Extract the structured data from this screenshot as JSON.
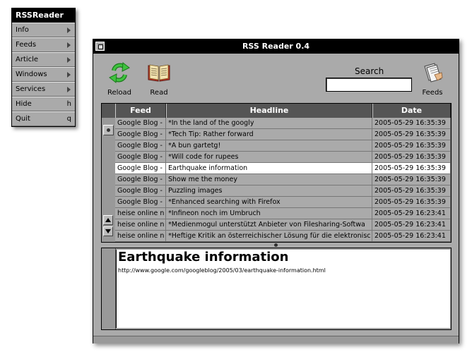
{
  "app_menu": {
    "title": "RSSReader",
    "items": [
      {
        "label": "Info",
        "key": ""
      },
      {
        "label": "Feeds",
        "key": ""
      },
      {
        "label": "Article",
        "key": ""
      },
      {
        "label": "Windows",
        "key": ""
      },
      {
        "label": "Services",
        "key": ""
      },
      {
        "label": "Hide",
        "key": "h"
      },
      {
        "label": "Quit",
        "key": "q"
      }
    ]
  },
  "window": {
    "title": "RSS Reader 0.4"
  },
  "toolbar": {
    "reload_label": "Reload",
    "read_label": "Read",
    "search_label": "Search",
    "search_value": "",
    "feeds_label": "Feeds"
  },
  "table": {
    "columns": [
      "Feed",
      "Headline",
      "Date"
    ],
    "rows": [
      {
        "feed": "Google Blog - ",
        "headline": "*In the land of the googly",
        "date": "2005-05-29 16:35:39",
        "selected": false
      },
      {
        "feed": "Google Blog - ",
        "headline": "*Tech Tip: Rather forward",
        "date": "2005-05-29 16:35:39",
        "selected": false
      },
      {
        "feed": "Google Blog - ",
        "headline": "*A bun gartetg!",
        "date": "2005-05-29 16:35:39",
        "selected": false
      },
      {
        "feed": "Google Blog - ",
        "headline": "*Will code for rupees",
        "date": "2005-05-29 16:35:39",
        "selected": false
      },
      {
        "feed": "Google Blog - ",
        "headline": "Earthquake information",
        "date": "2005-05-29 16:35:39",
        "selected": true
      },
      {
        "feed": "Google Blog - ",
        "headline": "Show me the money",
        "date": "2005-05-29 16:35:39",
        "selected": false
      },
      {
        "feed": "Google Blog - ",
        "headline": "Puzzling images",
        "date": "2005-05-29 16:35:39",
        "selected": false
      },
      {
        "feed": "Google Blog - ",
        "headline": "*Enhanced searching with Firefox",
        "date": "2005-05-29 16:35:39",
        "selected": false
      },
      {
        "feed": "heise online n",
        "headline": "*Infineon noch im Umbruch",
        "date": "2005-05-29 16:23:41",
        "selected": false
      },
      {
        "feed": "heise online n",
        "headline": "*Medienmogul unterstützt Anbieter von Filesharing-Softwa",
        "date": "2005-05-29 16:23:41",
        "selected": false
      },
      {
        "feed": "heise online n",
        "headline": "*Heftige Kritik an österreichischer Lösung für die elektronisc",
        "date": "2005-05-29 16:23:41",
        "selected": false
      }
    ]
  },
  "article": {
    "title": "Earthquake information",
    "link": "http://www.google.com/googleblog/2005/03/earthquake-information.html"
  },
  "icons": {
    "reload": "reload-icon",
    "read": "book-icon",
    "feeds": "feeds-icon"
  },
  "colors": {
    "chrome": "#aaaaaa",
    "title_bar": "#000000",
    "selection": "#ffffff",
    "reload_green": "#2aa02a"
  }
}
